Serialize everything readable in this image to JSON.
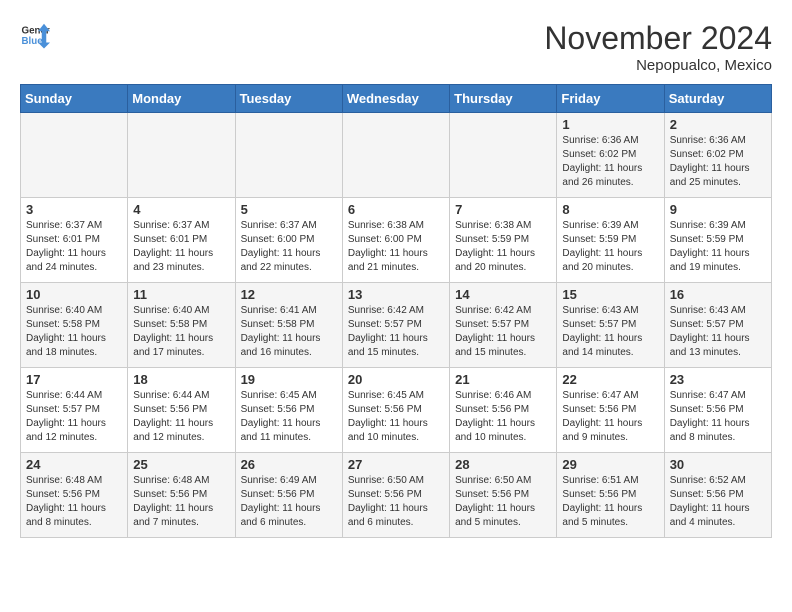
{
  "header": {
    "logo_general": "General",
    "logo_blue": "Blue",
    "month_title": "November 2024",
    "location": "Nepopualco, Mexico"
  },
  "days_of_week": [
    "Sunday",
    "Monday",
    "Tuesday",
    "Wednesday",
    "Thursday",
    "Friday",
    "Saturday"
  ],
  "weeks": [
    [
      {
        "day": "",
        "info": ""
      },
      {
        "day": "",
        "info": ""
      },
      {
        "day": "",
        "info": ""
      },
      {
        "day": "",
        "info": ""
      },
      {
        "day": "",
        "info": ""
      },
      {
        "day": "1",
        "info": "Sunrise: 6:36 AM\nSunset: 6:02 PM\nDaylight: 11 hours and 26 minutes."
      },
      {
        "day": "2",
        "info": "Sunrise: 6:36 AM\nSunset: 6:02 PM\nDaylight: 11 hours and 25 minutes."
      }
    ],
    [
      {
        "day": "3",
        "info": "Sunrise: 6:37 AM\nSunset: 6:01 PM\nDaylight: 11 hours and 24 minutes."
      },
      {
        "day": "4",
        "info": "Sunrise: 6:37 AM\nSunset: 6:01 PM\nDaylight: 11 hours and 23 minutes."
      },
      {
        "day": "5",
        "info": "Sunrise: 6:37 AM\nSunset: 6:00 PM\nDaylight: 11 hours and 22 minutes."
      },
      {
        "day": "6",
        "info": "Sunrise: 6:38 AM\nSunset: 6:00 PM\nDaylight: 11 hours and 21 minutes."
      },
      {
        "day": "7",
        "info": "Sunrise: 6:38 AM\nSunset: 5:59 PM\nDaylight: 11 hours and 20 minutes."
      },
      {
        "day": "8",
        "info": "Sunrise: 6:39 AM\nSunset: 5:59 PM\nDaylight: 11 hours and 20 minutes."
      },
      {
        "day": "9",
        "info": "Sunrise: 6:39 AM\nSunset: 5:59 PM\nDaylight: 11 hours and 19 minutes."
      }
    ],
    [
      {
        "day": "10",
        "info": "Sunrise: 6:40 AM\nSunset: 5:58 PM\nDaylight: 11 hours and 18 minutes."
      },
      {
        "day": "11",
        "info": "Sunrise: 6:40 AM\nSunset: 5:58 PM\nDaylight: 11 hours and 17 minutes."
      },
      {
        "day": "12",
        "info": "Sunrise: 6:41 AM\nSunset: 5:58 PM\nDaylight: 11 hours and 16 minutes."
      },
      {
        "day": "13",
        "info": "Sunrise: 6:42 AM\nSunset: 5:57 PM\nDaylight: 11 hours and 15 minutes."
      },
      {
        "day": "14",
        "info": "Sunrise: 6:42 AM\nSunset: 5:57 PM\nDaylight: 11 hours and 15 minutes."
      },
      {
        "day": "15",
        "info": "Sunrise: 6:43 AM\nSunset: 5:57 PM\nDaylight: 11 hours and 14 minutes."
      },
      {
        "day": "16",
        "info": "Sunrise: 6:43 AM\nSunset: 5:57 PM\nDaylight: 11 hours and 13 minutes."
      }
    ],
    [
      {
        "day": "17",
        "info": "Sunrise: 6:44 AM\nSunset: 5:57 PM\nDaylight: 11 hours and 12 minutes."
      },
      {
        "day": "18",
        "info": "Sunrise: 6:44 AM\nSunset: 5:56 PM\nDaylight: 11 hours and 12 minutes."
      },
      {
        "day": "19",
        "info": "Sunrise: 6:45 AM\nSunset: 5:56 PM\nDaylight: 11 hours and 11 minutes."
      },
      {
        "day": "20",
        "info": "Sunrise: 6:45 AM\nSunset: 5:56 PM\nDaylight: 11 hours and 10 minutes."
      },
      {
        "day": "21",
        "info": "Sunrise: 6:46 AM\nSunset: 5:56 PM\nDaylight: 11 hours and 10 minutes."
      },
      {
        "day": "22",
        "info": "Sunrise: 6:47 AM\nSunset: 5:56 PM\nDaylight: 11 hours and 9 minutes."
      },
      {
        "day": "23",
        "info": "Sunrise: 6:47 AM\nSunset: 5:56 PM\nDaylight: 11 hours and 8 minutes."
      }
    ],
    [
      {
        "day": "24",
        "info": "Sunrise: 6:48 AM\nSunset: 5:56 PM\nDaylight: 11 hours and 8 minutes."
      },
      {
        "day": "25",
        "info": "Sunrise: 6:48 AM\nSunset: 5:56 PM\nDaylight: 11 hours and 7 minutes."
      },
      {
        "day": "26",
        "info": "Sunrise: 6:49 AM\nSunset: 5:56 PM\nDaylight: 11 hours and 6 minutes."
      },
      {
        "day": "27",
        "info": "Sunrise: 6:50 AM\nSunset: 5:56 PM\nDaylight: 11 hours and 6 minutes."
      },
      {
        "day": "28",
        "info": "Sunrise: 6:50 AM\nSunset: 5:56 PM\nDaylight: 11 hours and 5 minutes."
      },
      {
        "day": "29",
        "info": "Sunrise: 6:51 AM\nSunset: 5:56 PM\nDaylight: 11 hours and 5 minutes."
      },
      {
        "day": "30",
        "info": "Sunrise: 6:52 AM\nSunset: 5:56 PM\nDaylight: 11 hours and 4 minutes."
      }
    ]
  ]
}
